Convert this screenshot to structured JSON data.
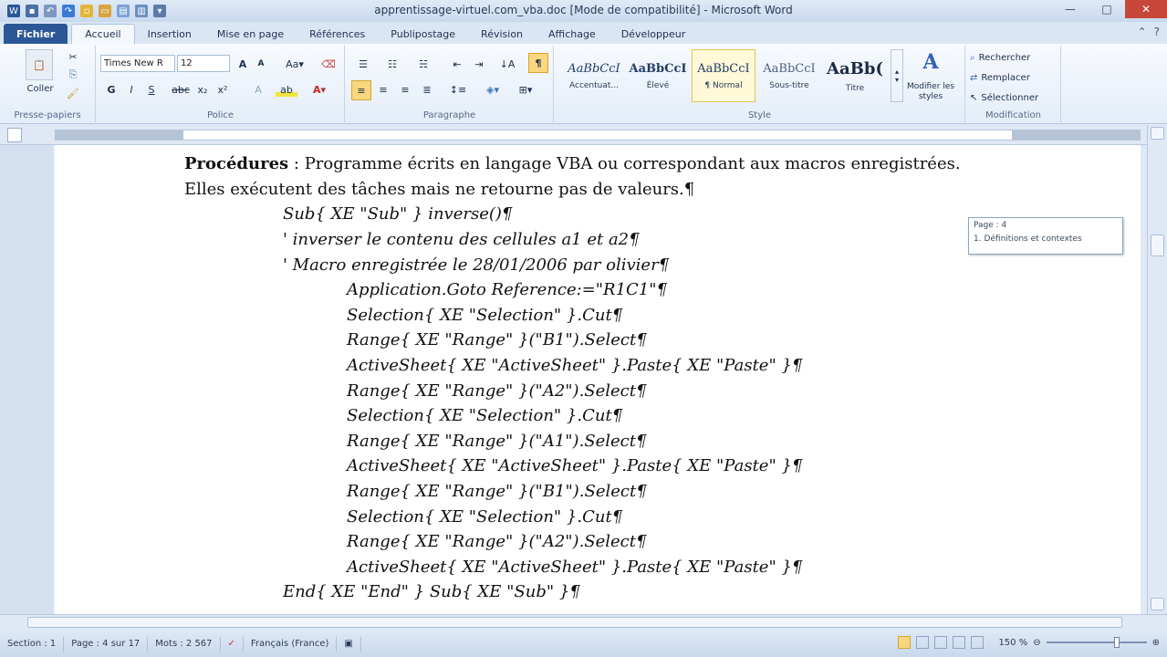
{
  "window": {
    "title": "apprentissage-virtuel.com_vba.doc [Mode de compatibilité] - Microsoft Word",
    "minimize": "—",
    "maximize": "□",
    "close": "✕"
  },
  "tabs": [
    "Fichier",
    "Accueil",
    "Insertion",
    "Mise en page",
    "Références",
    "Publipostage",
    "Révision",
    "Affichage",
    "Développeur"
  ],
  "ribbon": {
    "clipboard": {
      "paste": "Coller",
      "group": "Presse-papiers"
    },
    "font": {
      "name": "Times New R",
      "size": "12",
      "group": "Police"
    },
    "paragraph": {
      "group": "Paragraphe"
    },
    "styles": {
      "group": "Style",
      "items": [
        {
          "sample": "AaBbCcI",
          "name": "Accentuat..."
        },
        {
          "sample": "AaBbCcI",
          "name": "Élevé"
        },
        {
          "sample": "AaBbCcI",
          "name": "¶ Normal"
        },
        {
          "sample": "AaBbCcI",
          "name": "Sous-titre"
        },
        {
          "sample": "AaBb(",
          "name": "Titre"
        }
      ],
      "modify": "Modifier les styles"
    },
    "editing": {
      "search": "Rechercher",
      "replace": "Remplacer",
      "select": "Sélectionner",
      "group": "Modification"
    }
  },
  "document": {
    "line1_bold": "Procédures",
    "line1_rest": " : Programme écrits en langage VBA ou correspondant aux macros enregistrées.",
    "line2": "Elles exécutent des tâches mais ne retourne pas de valeurs.¶",
    "code": [
      "Sub{ XE \"Sub\" } inverse()¶",
      "' inverser le contenu des cellules a1 et a2¶",
      "' Macro enregistrée le 28/01/2006 par olivier¶",
      "Application.Goto Reference:=\"R1C1\"¶",
      "Selection{ XE \"Selection\" }.Cut¶",
      "Range{ XE \"Range\" }(\"B1\").Select¶",
      "ActiveSheet{ XE \"ActiveSheet\" }.Paste{ XE \"Paste\" }¶",
      "Range{ XE \"Range\" }(\"A2\").Select¶",
      "Selection{ XE \"Selection\" }.Cut¶",
      "Range{ XE \"Range\" }(\"A1\").Select¶",
      "ActiveSheet{ XE \"ActiveSheet\" }.Paste{ XE \"Paste\" }¶",
      "Range{ XE \"Range\" }(\"B1\").Select¶",
      "Selection{ XE \"Selection\" }.Cut¶",
      "Range{ XE \"Range\" }(\"A2\").Select¶",
      "ActiveSheet{ XE \"ActiveSheet\" }.Paste{ XE \"Paste\" }¶",
      "End{ XE \"End\" } Sub{ XE \"Sub\" }¶"
    ]
  },
  "tooltip": {
    "page": "Page : 4",
    "section": "1. Définitions et contextes"
  },
  "status": {
    "section": "Section : 1",
    "page": "Page : 4 sur 17",
    "words": "Mots : 2 567",
    "language": "Français (France)",
    "zoom": "150 %"
  }
}
